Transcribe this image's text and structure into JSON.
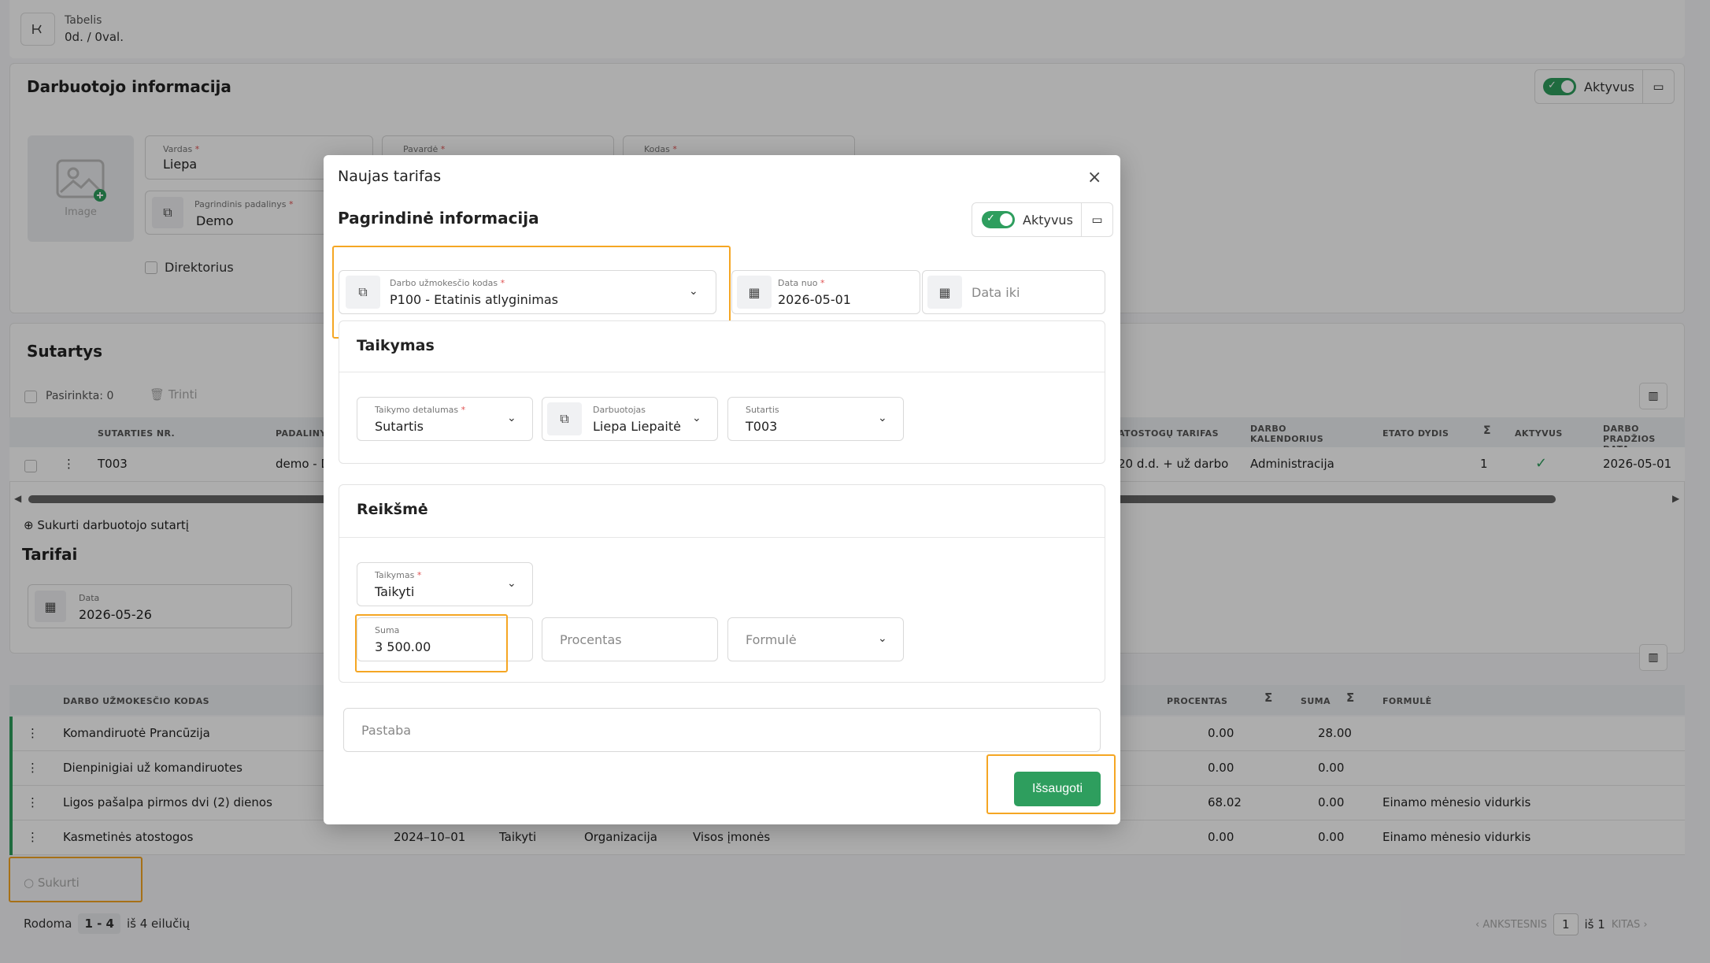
{
  "topbar": {
    "title": "Tabelis",
    "value": "0d. / 0val."
  },
  "employee": {
    "header": "Darbuotojo informacija",
    "active_label": "Aktyvus",
    "image_label": "Image",
    "first_name": {
      "label": "Vardas",
      "value": "Liepa"
    },
    "last_name": {
      "label": "Pavardė"
    },
    "code": {
      "label": "Kodas"
    },
    "department": {
      "label": "Pagrindinis padalinys",
      "value": "Demo"
    },
    "director_label": "Direktorius"
  },
  "contracts": {
    "title": "Sutartys",
    "selected": "Pasirinkta: 0",
    "delete": "Trinti",
    "columns": [
      "SUTARTIES NR.",
      "PADALINYS",
      "ATOSTOGŲ TARIFAS",
      "DARBO KALENDORIUS",
      "ETATO DYDIS",
      "AKTYVUS",
      "DARBO PRADŽIOS DATA"
    ],
    "row": {
      "number": "T003",
      "department": "demo - D",
      "vacation": "20 d.d. + už darbo",
      "calendar": "Administracija",
      "fte": "1",
      "start": "2026-05-01"
    },
    "create_link": "Sukurti darbuotojo sutartį"
  },
  "tarifai": {
    "title": "Tarifai",
    "date_label": "Data",
    "date_value": "2026-05-26",
    "columns": {
      "code": "DARBO UŽMOKESČIO KODAS",
      "percent": "PROCENTAS",
      "sum": "SUMA",
      "formula": "FORMULĖ"
    },
    "rows": [
      {
        "name": "Komandiruotė Prancūzija",
        "date": "",
        "apply": "",
        "scope": "",
        "who": "",
        "percent": "0.00",
        "sum": "28.00",
        "formula": ""
      },
      {
        "name": "Dienpinigiai už komandiruotes",
        "date": "",
        "apply": "",
        "scope": "",
        "who": "",
        "percent": "0.00",
        "sum": "0.00",
        "formula": ""
      },
      {
        "name": "Ligos pašalpa pirmos dvi (2) dienos",
        "date": "",
        "apply": "",
        "scope": "",
        "who": "",
        "percent": "68.02",
        "sum": "0.00",
        "formula": "Einamo mėnesio vidurkis"
      },
      {
        "name": "Kasmetinės atostogos",
        "date": "2024–10–01",
        "apply": "Taikyti",
        "scope": "Organizacija",
        "who": "Visos įmonės",
        "percent": "0.00",
        "sum": "0.00",
        "formula": "Einamo mėnesio vidurkis"
      }
    ],
    "create": "Sukurti",
    "showing_prefix": "Rodoma",
    "showing_range": "1 - 4",
    "showing_suffix": "iš 4 eilučių",
    "prev": "ANKSTESNIS",
    "page": "1",
    "of": "iš",
    "total_pages": "1",
    "next": "KITAS"
  },
  "modal": {
    "title": "Naujas tarifas",
    "main_section": "Pagrindinė informacija",
    "active_label": "Aktyvus",
    "pay_code": {
      "label": "Darbo užmokesčio kodas",
      "value": "P100 - Etatinis atlyginimas"
    },
    "date_from": {
      "label": "Data nuo",
      "value": "2026-05-01"
    },
    "date_to": {
      "placeholder": "Data iki"
    },
    "application": {
      "title": "Taikymas",
      "detail": {
        "label": "Taikymo detalumas",
        "value": "Sutartis"
      },
      "employee": {
        "label": "Darbuotojas",
        "value": "Liepa Liepaitė"
      },
      "contract": {
        "label": "Sutartis",
        "value": "T003"
      }
    },
    "value_section": {
      "title": "Reikšmė",
      "apply": {
        "label": "Taikymas",
        "value": "Taikyti"
      },
      "sum": {
        "label": "Suma",
        "value": "3 500.00"
      },
      "percent_placeholder": "Procentas",
      "formula_placeholder": "Formulė"
    },
    "note_placeholder": "Pastaba",
    "save": "Išsaugoti"
  }
}
